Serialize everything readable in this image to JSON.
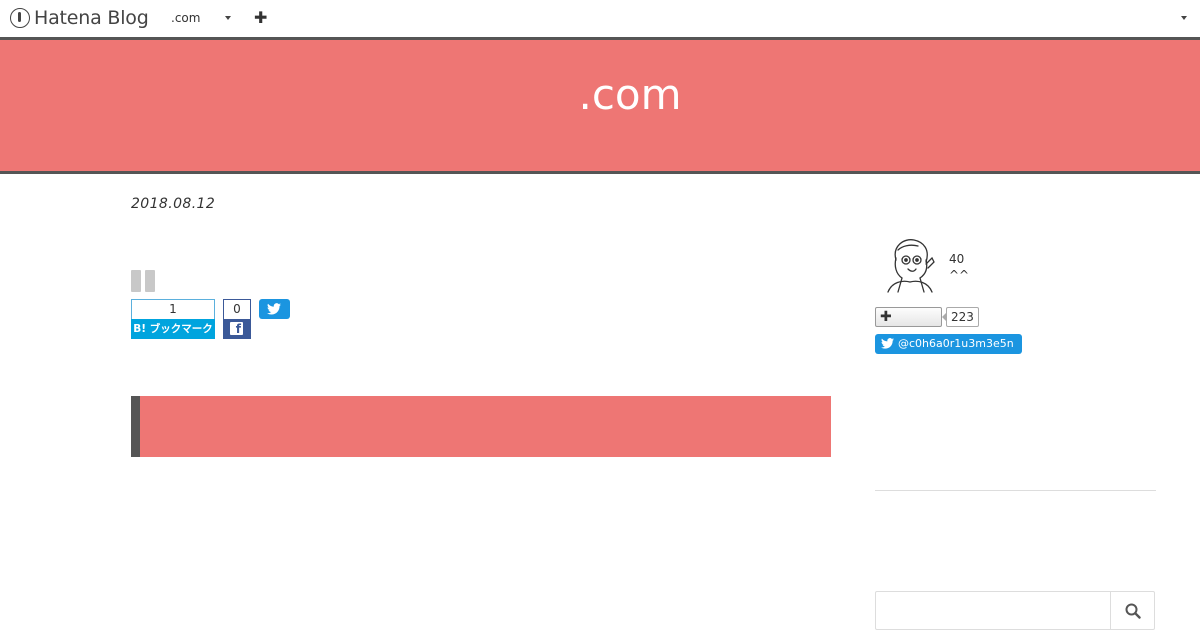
{
  "topbar": {
    "logo_text": "Hatena Blog",
    "blog_name": ".com"
  },
  "header": {
    "blog_title": ".com",
    "accent_color": "#ee7674",
    "border_color": "#555555"
  },
  "entry": {
    "date": "2018.08.12",
    "hatena_bookmark": {
      "count": "1",
      "label": "B! ブックマーク",
      "color": "#00a4de"
    },
    "facebook": {
      "count": "0",
      "icon": "facebook-icon",
      "color": "#3b5998"
    },
    "twitter": {
      "icon": "twitter-icon",
      "color": "#1b95e0"
    }
  },
  "sidebar": {
    "profile": {
      "number": "40",
      "face": "^^"
    },
    "follow": {
      "count": "223"
    },
    "twitter_handle": "@c0h6a0r1u3m3e5n",
    "search": {
      "placeholder": ""
    }
  }
}
